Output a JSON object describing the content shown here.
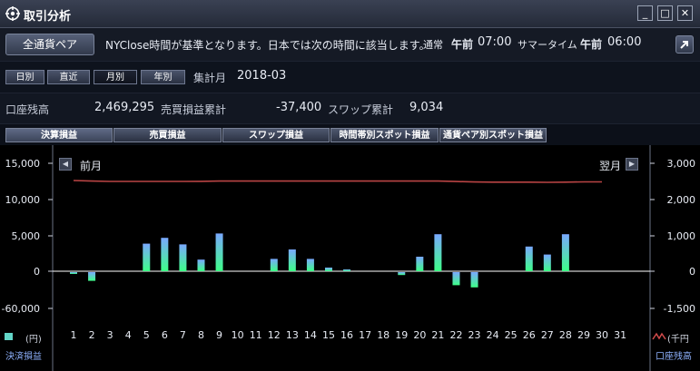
{
  "window": {
    "title": "取引分析",
    "buttons": [
      "_",
      "□",
      "✕"
    ],
    "icon": "target-icon"
  },
  "header": {
    "pair_button": "全通貨ペア",
    "notice": "NYClose時間が基準となります。日本では次の時間に該当します。",
    "normal_label": "通常",
    "normal_ampm": "午前",
    "normal_time": "07:00",
    "summer_label": "サマータイム",
    "summer_ampm": "午前",
    "summer_time": "06:00"
  },
  "periods": {
    "items": [
      "日別",
      "直近",
      "月別",
      "年別"
    ],
    "active": "月別",
    "label": "集計月",
    "value": "2018-03"
  },
  "summary": {
    "balance_label": "口座残高",
    "balance_value": "2,469,295",
    "trade_label": "売買損益累計",
    "trade_value": "-37,400",
    "swap_label": "スワップ累計",
    "swap_value": "9,034"
  },
  "tabs": {
    "items": [
      "決算損益",
      "売買損益",
      "スワップ損益",
      "時間帯別スポット損益",
      "通貨ペア別スポット損益"
    ],
    "active": "決算損益"
  },
  "chart_nav": {
    "prev": "前月",
    "next": "翌月"
  },
  "legend": {
    "left_unit": "(円)",
    "left_series": "決済損益",
    "right_unit": "(千円",
    "right_series": "口座残高"
  },
  "colors": {
    "bar_top": "#7aa8ff",
    "bar_bottom": "#3dff87",
    "line": "#b94444",
    "grid": "#ffffff"
  },
  "chart_data": {
    "type": "bar",
    "categories": [
      "1",
      "2",
      "3",
      "4",
      "5",
      "6",
      "7",
      "8",
      "9",
      "10",
      "11",
      "12",
      "13",
      "14",
      "15",
      "16",
      "17",
      "18",
      "19",
      "20",
      "21",
      "22",
      "23",
      "24",
      "25",
      "26",
      "27",
      "28",
      "29",
      "30",
      "31"
    ],
    "left_ticks": [
      "15,000",
      "10,000",
      "5,000",
      "0",
      "-60,000"
    ],
    "right_ticks": [
      "3,000",
      "2,000",
      "1,000",
      "0",
      "-1,500"
    ],
    "series": [
      {
        "name": "決済損益",
        "values": [
          -200,
          -1200,
          0,
          0,
          3800,
          4600,
          3700,
          1600,
          5200,
          0,
          0,
          1700,
          3000,
          1700,
          500,
          200,
          0,
          0,
          -400,
          2000,
          5100,
          -1800,
          -2100,
          0,
          0,
          3400,
          2300,
          5100,
          0,
          0,
          0
        ]
      },
      {
        "name": "口座残高",
        "values": [
          2501,
          2485,
          2476,
          2474,
          2476,
          2476,
          2476,
          2477,
          2485,
          2485,
          2485,
          2485,
          2485,
          2485,
          2485,
          2485,
          2485,
          2485,
          2485,
          2485,
          2485,
          2472,
          2460,
          2455,
          2455,
          2455,
          2450,
          2455,
          2462,
          2462,
          null
        ]
      }
    ]
  }
}
